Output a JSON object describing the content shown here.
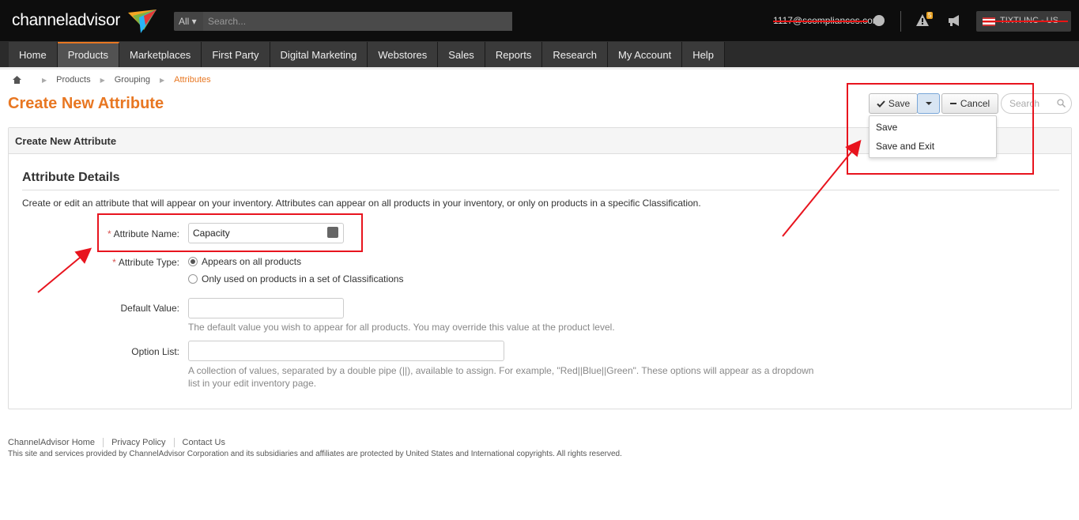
{
  "header": {
    "logo_text": "channeladvisor",
    "search_scope": "All",
    "search_placeholder": "Search...",
    "user_email": "1117@scompliances.com",
    "alert_count": "5",
    "account_name": "TIXTI INC - US"
  },
  "nav": {
    "items": [
      "Home",
      "Products",
      "Marketplaces",
      "First Party",
      "Digital Marketing",
      "Webstores",
      "Sales",
      "Reports",
      "Research",
      "My Account",
      "Help"
    ],
    "active": "Products"
  },
  "breadcrumb": {
    "items": [
      "Products",
      "Grouping"
    ],
    "current": "Attributes"
  },
  "page": {
    "title": "Create New Attribute"
  },
  "toolbar": {
    "save_label": "Save",
    "cancel_label": "Cancel",
    "search_placeholder": "Search",
    "dropdown_items": [
      "Save",
      "Save and Exit"
    ]
  },
  "panel": {
    "heading": "Create New Attribute",
    "section_title": "Attribute Details",
    "description": "Create or edit an attribute that will appear on your inventory. Attributes can appear on all products in your inventory, or only on products in a specific Classification."
  },
  "form": {
    "name_label": "Attribute Name:",
    "name_value": "Capacity",
    "type_label": "Attribute Type:",
    "type_options": [
      "Appears on all products",
      "Only used on products in a set of Classifications"
    ],
    "type_selected": "Appears on all products",
    "default_label": "Default Value:",
    "default_value": "",
    "default_help": "The default value you wish to appear for all products. You may override this value at the product level.",
    "option_label": "Option List:",
    "option_value": "",
    "option_help_line1": "A collection of values, separated by a double pipe (||), available to assign. For example, \"Red||Blue||Green\". These options will appear as a dropdown",
    "option_help_line2": "list in your edit inventory page."
  },
  "footer": {
    "links": [
      "ChannelAdvisor Home",
      "Privacy Policy",
      "Contact Us"
    ],
    "copyright": "This site and services provided by ChannelAdvisor Corporation and its subsidiaries and affiliates are protected by United States and International copyrights. All rights reserved."
  },
  "colors": {
    "brand_orange": "#e87722",
    "annotation_red": "#e8141e",
    "topbar": "#0d0d0d",
    "navbar": "#2b2b2b"
  }
}
